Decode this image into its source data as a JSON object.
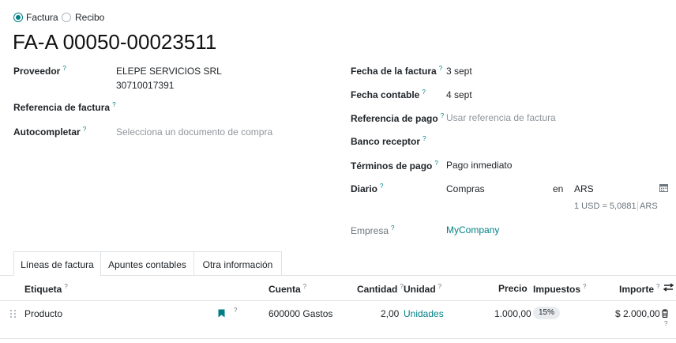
{
  "doc_type": {
    "option_invoice": "Factura",
    "option_receipt": "Recibo",
    "selected": "Factura"
  },
  "title": "FA-A 00050-00023511",
  "left": {
    "supplier_label": "Proveedor",
    "supplier_name": "ELEPE SERVICIOS SRL",
    "supplier_tax_id": "30710017391",
    "invoice_ref_label": "Referencia de factura",
    "autocomplete_label": "Autocompletar",
    "autocomplete_placeholder": "Selecciona un documento de compra"
  },
  "right": {
    "invoice_date_label": "Fecha de la factura",
    "invoice_date": "3 sept",
    "accounting_date_label": "Fecha contable",
    "accounting_date": "4 sept",
    "payment_ref_label": "Referencia de pago",
    "payment_ref_placeholder": "Usar referencia de factura",
    "bank_label": "Banco receptor",
    "terms_label": "Términos de pago",
    "terms_value": "Pago inmediato",
    "journal_label": "Diario",
    "journal_value": "Compras",
    "in_label": "en",
    "currency": "ARS",
    "rate_text": "1 USD = 5,0881",
    "rate_currency": "ARS",
    "company_label": "Empresa",
    "company_value": "MyCompany"
  },
  "help_mark": "?",
  "tabs": [
    "Líneas de factura",
    "Apuntes contables",
    "Otra información"
  ],
  "table": {
    "headers": {
      "label": "Etiqueta",
      "account": "Cuenta",
      "quantity": "Cantidad",
      "unit": "Unidad",
      "price": "Precio",
      "taxes": "Impuestos",
      "amount": "Importe"
    },
    "row": {
      "label": "Producto",
      "account": "600000 Gastos",
      "quantity": "2,00",
      "unit": "Unidades",
      "price": "1.000,00",
      "tax": "15%",
      "amount": "$ 2.000,00"
    }
  },
  "colors": {
    "accent": "#017e84",
    "muted_text": "#8f959b",
    "border": "#dee2e6"
  },
  "icons": [
    "radio-icon",
    "calendar-icon",
    "bookmark-icon",
    "drag-handle-icon",
    "trash-icon",
    "column-settings-icon"
  ]
}
